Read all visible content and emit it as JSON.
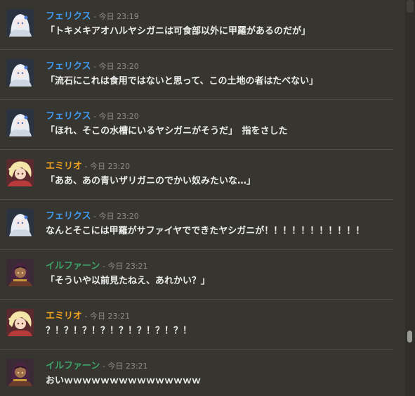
{
  "colors": {
    "felix": "#3e9bf2",
    "emilio": "#f2a321",
    "ilfarn": "#3fa46a",
    "background": "#36352f",
    "text": "#eeeeee",
    "timestamp": "#8e8d87"
  },
  "messages": [
    {
      "author": "フェリクス",
      "time": " - 今日 23:19",
      "text": "「トキメキアオハルヤシガニは可食部以外に甲羅があるのだが」",
      "avatar": "felix-avatar",
      "author_key": "felix"
    },
    {
      "author": "フェリクス",
      "time": " - 今日 23:20",
      "text": "「流石にこれは食用ではないと思って、この土地の者はたべない」",
      "avatar": "felix-avatar",
      "author_key": "felix"
    },
    {
      "author": "フェリクス",
      "time": " - 今日 23:20",
      "text": "「ほれ、そこの水槽にいるヤシガニがそうだ」　指をさした",
      "avatar": "felix-avatar",
      "author_key": "felix"
    },
    {
      "author": "エミリオ",
      "time": " - 今日 23:20",
      "text": "「ああ、あの青いザリガニのでかい奴みたいな…」",
      "avatar": "emilio-avatar",
      "author_key": "emilio"
    },
    {
      "author": "フェリクス",
      "time": " - 今日 23:20",
      "text": "なんとそこには甲羅がサファイヤでできたヤシガニが！！！！！！！！！！！",
      "avatar": "felix-avatar",
      "author_key": "felix"
    },
    {
      "author": "イルファーン",
      "time": " - 今日 23:21",
      "text": "「そういや以前見たねえ、あれかい？」",
      "avatar": "ilfarn-avatar",
      "author_key": "ilfarn"
    },
    {
      "author": "エミリオ",
      "time": " - 今日 23:21",
      "text": "？！？！？！？！？！？！？！？！",
      "avatar": "emilio-avatar",
      "author_key": "emilio"
    },
    {
      "author": "イルファーン",
      "time": " - 今日 23:21",
      "text": "おいｗｗｗｗｗｗｗｗｗｗｗｗｗｗｗ",
      "avatar": "ilfarn-avatar",
      "author_key": "ilfarn"
    }
  ]
}
